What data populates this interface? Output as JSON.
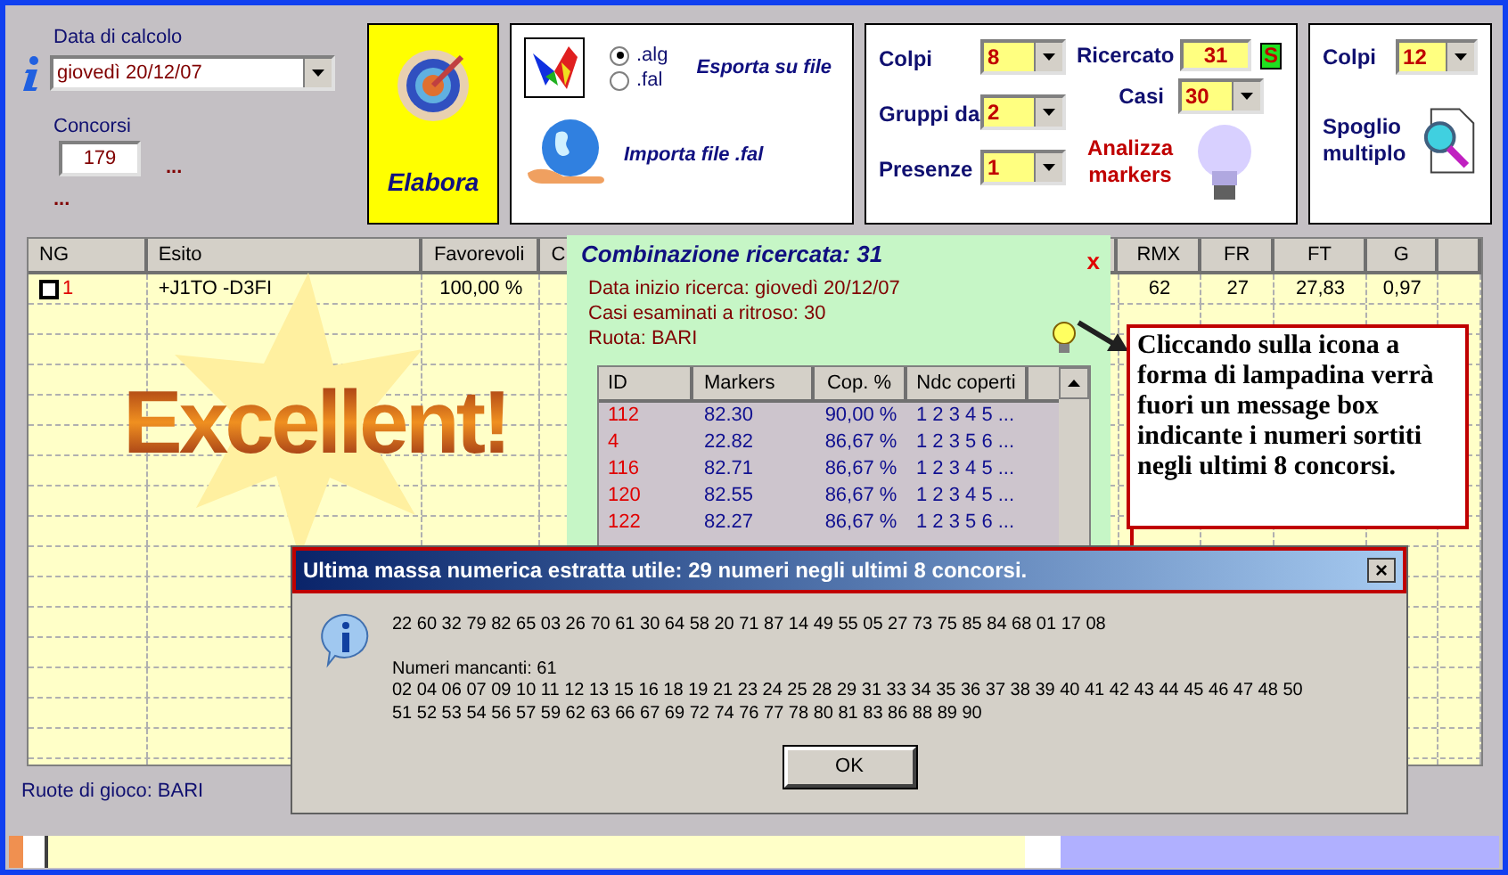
{
  "calc_date": {
    "label": "Data di calcolo",
    "value": "giovedì 20/12/07"
  },
  "concorsi": {
    "label": "Concorsi",
    "value": "179",
    "more": "...",
    "more_below": "..."
  },
  "elabora_button": {
    "label": "Elabora"
  },
  "export_panel": {
    "formats": [
      {
        "label": ".alg",
        "selected": true
      },
      {
        "label": ".fal",
        "selected": false
      }
    ],
    "export_label": "Esporta su file",
    "import_label": "Importa file .fal"
  },
  "markers_panel": {
    "colpi": {
      "label": "Colpi",
      "value": "8"
    },
    "gruppi": {
      "label": "Gruppi da",
      "value": "2"
    },
    "presenze": {
      "label": "Presenze",
      "value": "1"
    },
    "ricercato": {
      "label": "Ricercato",
      "value": "31",
      "badge": "S"
    },
    "casi": {
      "label": "Casi",
      "value": "30"
    },
    "analyze_label": "Analizza markers"
  },
  "spoglio_panel": {
    "colpi": {
      "label": "Colpi",
      "value": "12"
    },
    "label": "Spoglio multiplo"
  },
  "table": {
    "columns": [
      "NG",
      "Esito",
      "Favorevoli",
      "C",
      "RMX",
      "FR",
      "FT",
      "G"
    ],
    "rows": [
      {
        "checked": false,
        "ng": "1",
        "esito": "+J1TO -D3FI",
        "favorevoli": "100,00 %",
        "rmx": "62",
        "fr": "27",
        "ft": "27,83",
        "g": "0,97"
      }
    ]
  },
  "wordart": "Excellent!",
  "combination_panel": {
    "title": "Combinazione ricercata: 31",
    "close": "x",
    "lines": [
      "Data inizio ricerca: giovedì 20/12/07",
      "Casi esaminati a ritroso: 30",
      "Ruota: BARI"
    ],
    "columns": [
      "ID",
      "Markers",
      "Cop. %",
      "Ndc coperti"
    ],
    "rows": [
      [
        "112",
        "82.30",
        "90,00 %",
        "1 2 3 4 5 ..."
      ],
      [
        "4",
        "22.82",
        "86,67 %",
        "1 2 3 5 6 ..."
      ],
      [
        "116",
        "82.71",
        "86,67 %",
        "1 2 3 4 5 ..."
      ],
      [
        "120",
        "82.55",
        "86,67 %",
        "1 2 3 4 5 ..."
      ],
      [
        "122",
        "82.27",
        "86,67 %",
        "1 2 3 5 6 ..."
      ]
    ]
  },
  "callout": "Cliccando sulla icona a forma di lampadina verrà fuori un message box indicante i numeri sortiti negli ultimi 8 concorsi.",
  "message_box": {
    "title": "Ultima massa numerica estratta utile: 29 numeri negli ultimi 8 concorsi.",
    "close": "×",
    "drawn": "22 60 32 79 82 65 03 26 70 61 30 64 58 20 71 87 14 49 55 05 27 73 75 85 84 68 01 17 08",
    "missing_label": "Numeri mancanti: 61",
    "missing_lines": [
      "02 04 06 07 09 10 11 12 13 15 16 18 19 21 23 24 25 28 29 31 33 34 35 36 37 38 39 40 41 42 43 44 45 46 47 48 50",
      "51 52 53 54 56 57 59 62 63 66 67 69 72 74 76 77 78 80 81 83 86 88 89 90"
    ],
    "ok": "OK"
  },
  "status": "Ruote di gioco: BARI"
}
